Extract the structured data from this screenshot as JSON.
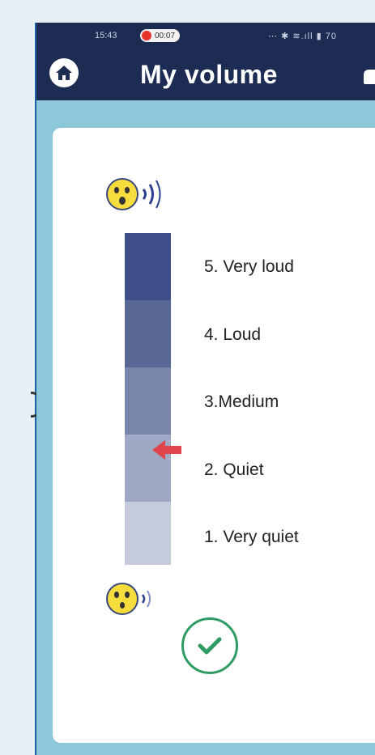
{
  "status_bar": {
    "time": "15:43",
    "record_timer": "00:07",
    "icons_text": "⋯ ✱ ≋.ıll ▮ 70"
  },
  "header": {
    "title": "My volume"
  },
  "levels": [
    {
      "label": "5. Very loud",
      "color": "#3e4f8a"
    },
    {
      "label": "4. Loud",
      "color": "#5a6898"
    },
    {
      "label": "3.Medium",
      "color": "#7b86ad"
    },
    {
      "label": "2. Quiet",
      "color": "#9fa8c4"
    },
    {
      "label": "1. Very quiet",
      "color": "#c5cbdd"
    }
  ],
  "selected_level": 2,
  "icons": {
    "home": "home-icon",
    "loud": "loud-face-icon",
    "quiet": "quiet-face-icon",
    "arrow": "arrow-left-icon",
    "confirm": "checkmark-icon"
  },
  "colors": {
    "header_bg": "#1c2c52",
    "frame_bg": "#8cc8da",
    "arrow": "#e0444c",
    "confirm": "#2e9b62"
  }
}
